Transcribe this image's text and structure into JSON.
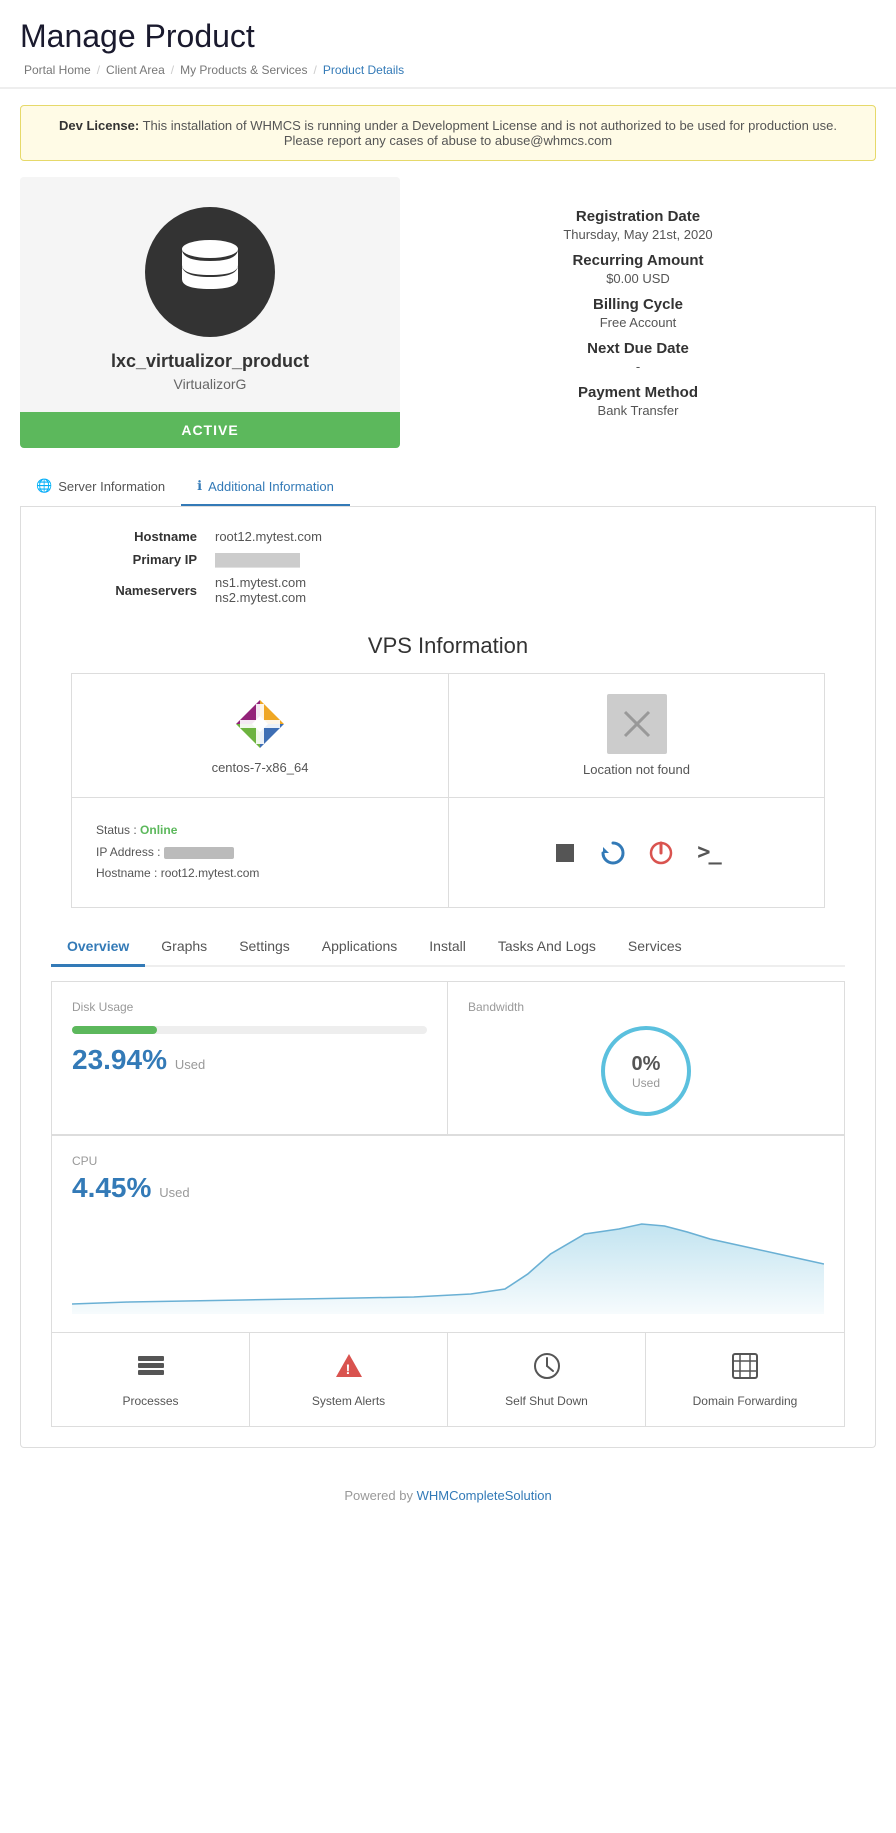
{
  "page": {
    "title": "Manage Product",
    "breadcrumbs": [
      {
        "label": "Portal Home",
        "active": false
      },
      {
        "label": "Client Area",
        "active": false
      },
      {
        "label": "My Products & Services",
        "active": false
      },
      {
        "label": "Product Details",
        "active": true
      }
    ]
  },
  "dev_banner": {
    "prefix": "Dev License:",
    "text": " This installation of WHMCS is running under a Development License and is not authorized to be used for production use. Please report any cases of abuse to abuse@whmcs.com"
  },
  "product": {
    "name": "lxc_virtualizor_product",
    "sub": "VirtualizorG",
    "status": "ACTIVE"
  },
  "product_info": {
    "registration_date_label": "Registration Date",
    "registration_date_value": "Thursday, May 21st, 2020",
    "recurring_amount_label": "Recurring Amount",
    "recurring_amount_value": "$0.00 USD",
    "billing_cycle_label": "Billing Cycle",
    "billing_cycle_value": "Free Account",
    "next_due_date_label": "Next Due Date",
    "next_due_date_value": "-",
    "payment_method_label": "Payment Method",
    "payment_method_value": "Bank Transfer"
  },
  "server_tabs": [
    {
      "label": "Server Information",
      "icon": "globe",
      "active": false
    },
    {
      "label": "Additional Information",
      "icon": "info",
      "active": true
    }
  ],
  "server_info": {
    "hostname_label": "Hostname",
    "hostname_value": "root12.mytest.com",
    "primary_ip_label": "Primary IP",
    "primary_ip_value": "██████████",
    "nameservers_label": "Nameservers",
    "ns1": "ns1.mytest.com",
    "ns2": "ns2.mytest.com"
  },
  "vps": {
    "section_title": "VPS Information",
    "os_label": "centos-7-x86_64",
    "location_label": "Location not found",
    "status_label": "Status :",
    "status_value": "Online",
    "ip_label": "IP Address :",
    "ip_value": "██████████",
    "hostname_label": "Hostname :",
    "hostname_value": "root12.mytest.com"
  },
  "overview_tabs": [
    {
      "label": "Overview",
      "active": true
    },
    {
      "label": "Graphs",
      "active": false
    },
    {
      "label": "Settings",
      "active": false
    },
    {
      "label": "Applications",
      "active": false
    },
    {
      "label": "Install",
      "active": false
    },
    {
      "label": "Tasks And Logs",
      "active": false
    },
    {
      "label": "Services",
      "active": false
    }
  ],
  "disk": {
    "label": "Disk Usage",
    "percent": 23.94,
    "percent_display": "23.94%",
    "used_label": "Used"
  },
  "bandwidth": {
    "label": "Bandwidth",
    "percent": 0,
    "percent_display": "0%",
    "used_label": "Used"
  },
  "cpu": {
    "label": "CPU",
    "percent": 4.45,
    "percent_display": "4.45%",
    "used_label": "Used"
  },
  "bottom_actions": [
    {
      "label": "Processes",
      "icon": "layers"
    },
    {
      "label": "System Alerts",
      "icon": "alert"
    },
    {
      "label": "Self Shut Down",
      "icon": "clock"
    },
    {
      "label": "Domain Forwarding",
      "icon": "globe2"
    }
  ],
  "footer": {
    "text": "Powered by ",
    "link_label": "WHMCompleteSolution",
    "link_url": "#"
  }
}
